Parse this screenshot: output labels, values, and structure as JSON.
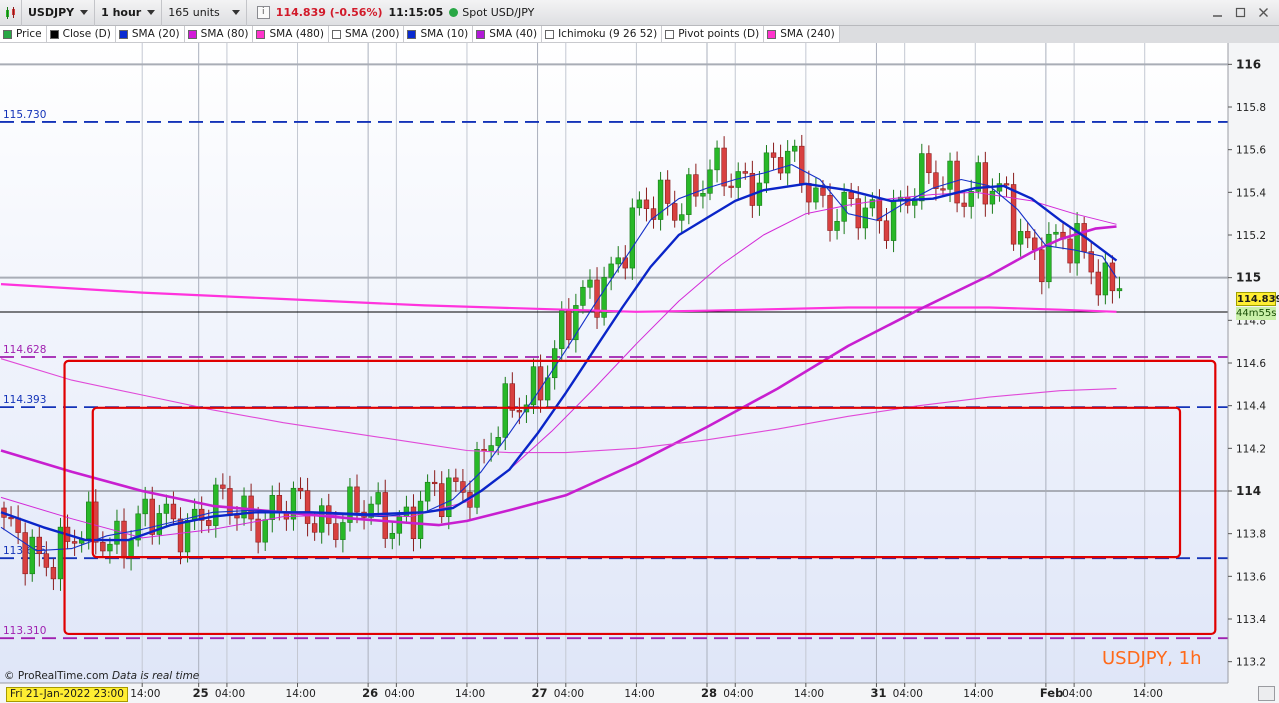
{
  "toolbar": {
    "symbol": "USDJPY",
    "timeframe": "1 hour",
    "units": "165 units",
    "info_icon": "i",
    "last_price": "114.839 (-0.56%)",
    "clock": "11:15:05",
    "instrument": "Spot USD/JPY",
    "colors": {
      "live": "#28a745",
      "negative": "#d11a2a"
    }
  },
  "legend": [
    {
      "label": "Price",
      "swatch": "#28a745",
      "icon": "candle-icon"
    },
    {
      "label": "Close (D)",
      "swatch": "#000000"
    },
    {
      "label": "SMA (20)",
      "swatch": "#0a2bd0"
    },
    {
      "label": "SMA (80)",
      "swatch": "#d21ad8"
    },
    {
      "label": "SMA (480)",
      "swatch": "#ff33cc"
    },
    {
      "label": "SMA (200)",
      "swatch": "#ffffff"
    },
    {
      "label": "SMA (10)",
      "swatch": "#0a2bd0"
    },
    {
      "label": "SMA (40)",
      "swatch": "#b21ad8"
    },
    {
      "label": "Ichimoku (9 26 52)",
      "swatch": "#ffffff"
    },
    {
      "label": "Pivot points (D)",
      "swatch": "#ffffff"
    },
    {
      "label": "SMA (240)",
      "swatch": "#ff33cc"
    }
  ],
  "footer": {
    "source": "© ProRealTime.com",
    "note": "Data is real time",
    "badge": "USDJPY, 1h",
    "first_date": "Fri 21-Jan-2022 23:00"
  },
  "price_tags": {
    "last": "114.839",
    "timer": "44m55s"
  },
  "chart_data": {
    "type": "candlestick",
    "instrument": "USDJPY",
    "interval": "1h",
    "ylim": [
      113.1,
      116.1
    ],
    "y_ticks": [
      {
        "v": 116,
        "label": "116",
        "major": true
      },
      {
        "v": 115.8,
        "label": "115.8"
      },
      {
        "v": 115.6,
        "label": "115.6"
      },
      {
        "v": 115.4,
        "label": "115.4"
      },
      {
        "v": 115.2,
        "label": "115.2"
      },
      {
        "v": 115,
        "label": "115",
        "major": true
      },
      {
        "v": 114.8,
        "label": "114.8"
      },
      {
        "v": 114.6,
        "label": "114.6"
      },
      {
        "v": 114.4,
        "label": "114.4"
      },
      {
        "v": 114.2,
        "label": "114.2"
      },
      {
        "v": 114,
        "label": "114",
        "major": true
      },
      {
        "v": 113.8,
        "label": "113.8"
      },
      {
        "v": 113.6,
        "label": "113.6"
      },
      {
        "v": 113.4,
        "label": "113.4"
      },
      {
        "v": 113.2,
        "label": "113.2"
      }
    ],
    "x_ticks": [
      {
        "bar": 20,
        "label": "14:00"
      },
      {
        "bar": 28,
        "label": "25",
        "day": true
      },
      {
        "bar": 32,
        "label": "04:00"
      },
      {
        "bar": 42,
        "label": "14:00"
      },
      {
        "bar": 52,
        "label": "26",
        "day": true
      },
      {
        "bar": 56,
        "label": "04:00"
      },
      {
        "bar": 66,
        "label": "14:00"
      },
      {
        "bar": 76,
        "label": "27",
        "day": true
      },
      {
        "bar": 80,
        "label": "04:00"
      },
      {
        "bar": 90,
        "label": "14:00"
      },
      {
        "bar": 100,
        "label": "28",
        "day": true
      },
      {
        "bar": 104,
        "label": "04:00"
      },
      {
        "bar": 114,
        "label": "14:00"
      },
      {
        "bar": 124,
        "label": "31",
        "day": true
      },
      {
        "bar": 128,
        "label": "04:00"
      },
      {
        "bar": 138,
        "label": "14:00"
      },
      {
        "bar": 148,
        "label": "Feb",
        "day": true
      },
      {
        "bar": 152,
        "label": "04:00"
      },
      {
        "bar": 162,
        "label": "14:00"
      }
    ],
    "last_bar": 158,
    "x_max_bar": 165,
    "level_lines": [
      {
        "value": 115.73,
        "label": "115.730",
        "color": "#1433b8",
        "style": "dashed"
      },
      {
        "value": 114.628,
        "label": "114.628",
        "color": "#a020b0",
        "style": "dashed"
      },
      {
        "value": 114.393,
        "label": "114.393",
        "color": "#1433b8",
        "style": "dashed"
      },
      {
        "value": 113.685,
        "label": "113.685",
        "color": "#1433b8",
        "style": "dashed"
      },
      {
        "value": 113.31,
        "label": "113.310",
        "color": "#a020b0",
        "style": "dashed"
      },
      {
        "value": 114.839,
        "label": "",
        "color": "#000000",
        "style": "solid"
      }
    ],
    "boxes": [
      {
        "x1": 9,
        "x2": 172,
        "y1": 114.61,
        "y2": 113.33,
        "color": "#e00000"
      },
      {
        "x1": 13,
        "x2": 167,
        "y1": 114.39,
        "y2": 113.69,
        "color": "#e00000"
      }
    ],
    "colors": {
      "up": "#28b828",
      "down": "#d84040",
      "up_edge": "#1a7a1a",
      "down_edge": "#8a1c1c"
    },
    "series": [
      {
        "name": "SMA (240)",
        "color": "#ff33dd",
        "width": 2.2,
        "points": [
          [
            0,
            114.97
          ],
          [
            20,
            114.93
          ],
          [
            40,
            114.9
          ],
          [
            60,
            114.87
          ],
          [
            80,
            114.85
          ],
          [
            90,
            114.84
          ],
          [
            100,
            114.845
          ],
          [
            120,
            114.86
          ],
          [
            140,
            114.86
          ],
          [
            150,
            114.85
          ],
          [
            158,
            114.84
          ]
        ]
      },
      {
        "name": "SMA (80)",
        "color": "#c81fd0",
        "width": 2.6,
        "points": [
          [
            0,
            114.19
          ],
          [
            10,
            114.09
          ],
          [
            20,
            114.0
          ],
          [
            30,
            113.93
          ],
          [
            40,
            113.9
          ],
          [
            50,
            113.87
          ],
          [
            58,
            113.85
          ],
          [
            62,
            113.84
          ],
          [
            66,
            113.86
          ],
          [
            72,
            113.91
          ],
          [
            80,
            113.98
          ],
          [
            90,
            114.13
          ],
          [
            100,
            114.3
          ],
          [
            110,
            114.48
          ],
          [
            120,
            114.68
          ],
          [
            130,
            114.85
          ],
          [
            140,
            115.01
          ],
          [
            146,
            115.12
          ],
          [
            150,
            115.18
          ],
          [
            155,
            115.23
          ],
          [
            158,
            115.24
          ]
        ]
      },
      {
        "name": "SMA (480)",
        "color": "#e04ad8",
        "width": 1.1,
        "points": [
          [
            0,
            114.62
          ],
          [
            10,
            114.52
          ],
          [
            20,
            114.45
          ],
          [
            30,
            114.38
          ],
          [
            40,
            114.32
          ],
          [
            50,
            114.27
          ],
          [
            60,
            114.22
          ],
          [
            66,
            114.19
          ],
          [
            72,
            114.18
          ],
          [
            80,
            114.18
          ],
          [
            90,
            114.2
          ],
          [
            100,
            114.24
          ],
          [
            110,
            114.29
          ],
          [
            120,
            114.35
          ],
          [
            130,
            114.4
          ],
          [
            140,
            114.44
          ],
          [
            150,
            114.47
          ],
          [
            158,
            114.48
          ]
        ]
      },
      {
        "name": "SMA (40)",
        "color": "#d32ad8",
        "width": 1.0,
        "points": [
          [
            0,
            113.97
          ],
          [
            10,
            113.87
          ],
          [
            20,
            113.78
          ],
          [
            30,
            113.82
          ],
          [
            40,
            113.88
          ],
          [
            50,
            113.89
          ],
          [
            58,
            113.88
          ],
          [
            66,
            113.95
          ],
          [
            72,
            114.1
          ],
          [
            78,
            114.28
          ],
          [
            84,
            114.48
          ],
          [
            90,
            114.69
          ],
          [
            96,
            114.89
          ],
          [
            102,
            115.06
          ],
          [
            108,
            115.2
          ],
          [
            114,
            115.3
          ],
          [
            120,
            115.34
          ],
          [
            126,
            115.37
          ],
          [
            132,
            115.39
          ],
          [
            138,
            115.4
          ],
          [
            146,
            115.36
          ],
          [
            152,
            115.3
          ],
          [
            158,
            115.25
          ]
        ]
      },
      {
        "name": "SMA (20)",
        "color": "#0a25c8",
        "width": 2.4,
        "points": [
          [
            0,
            113.9
          ],
          [
            6,
            113.83
          ],
          [
            12,
            113.77
          ],
          [
            18,
            113.77
          ],
          [
            24,
            113.84
          ],
          [
            30,
            113.88
          ],
          [
            36,
            113.9
          ],
          [
            44,
            113.9
          ],
          [
            52,
            113.89
          ],
          [
            60,
            113.9
          ],
          [
            64,
            113.92
          ],
          [
            68,
            114.0
          ],
          [
            72,
            114.1
          ],
          [
            76,
            114.27
          ],
          [
            80,
            114.46
          ],
          [
            84,
            114.66
          ],
          [
            88,
            114.86
          ],
          [
            92,
            115.05
          ],
          [
            96,
            115.2
          ],
          [
            100,
            115.28
          ],
          [
            104,
            115.36
          ],
          [
            108,
            115.41
          ],
          [
            114,
            115.44
          ],
          [
            120,
            115.41
          ],
          [
            126,
            115.36
          ],
          [
            132,
            115.37
          ],
          [
            138,
            115.42
          ],
          [
            142,
            115.43
          ],
          [
            146,
            115.37
          ],
          [
            150,
            115.27
          ],
          [
            154,
            115.18
          ],
          [
            158,
            115.08
          ]
        ]
      },
      {
        "name": "SMA (10)",
        "color": "#1430c8",
        "width": 1.1,
        "points": [
          [
            0,
            113.83
          ],
          [
            5,
            113.72
          ],
          [
            10,
            113.73
          ],
          [
            15,
            113.79
          ],
          [
            20,
            113.82
          ],
          [
            25,
            113.86
          ],
          [
            30,
            113.9
          ],
          [
            36,
            113.91
          ],
          [
            42,
            113.9
          ],
          [
            48,
            113.89
          ],
          [
            54,
            113.88
          ],
          [
            60,
            113.9
          ],
          [
            64,
            113.96
          ],
          [
            68,
            114.09
          ],
          [
            72,
            114.27
          ],
          [
            76,
            114.46
          ],
          [
            80,
            114.66
          ],
          [
            84,
            114.87
          ],
          [
            88,
            115.07
          ],
          [
            92,
            115.27
          ],
          [
            96,
            115.37
          ],
          [
            100,
            115.42
          ],
          [
            104,
            115.46
          ],
          [
            108,
            115.49
          ],
          [
            112,
            115.53
          ],
          [
            116,
            115.46
          ],
          [
            120,
            115.3
          ],
          [
            124,
            115.27
          ],
          [
            128,
            115.35
          ],
          [
            132,
            115.42
          ],
          [
            136,
            115.46
          ],
          [
            140,
            115.43
          ],
          [
            144,
            115.32
          ],
          [
            148,
            115.15
          ],
          [
            152,
            115.13
          ],
          [
            156,
            115.1
          ],
          [
            158,
            115.0
          ]
        ]
      }
    ]
  }
}
